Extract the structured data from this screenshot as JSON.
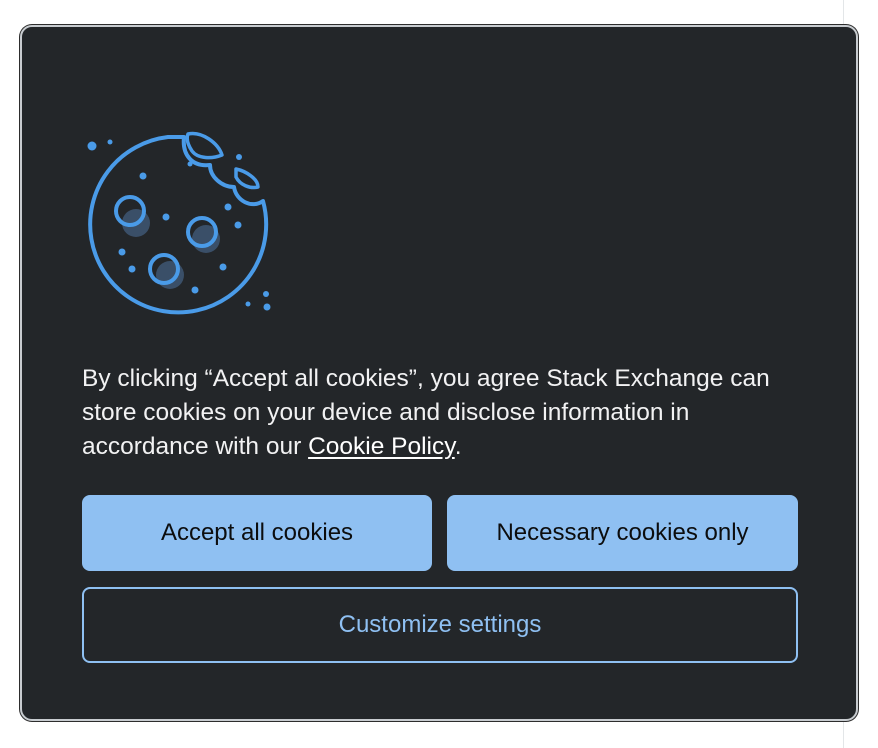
{
  "dialog": {
    "message_prefix": "By clicking “Accept all cookies”, you agree Stack Exchange can store cookies on your device and disclose information in accordance with our ",
    "policy_link": "Cookie Policy",
    "message_suffix": ".",
    "icon": "cookie-icon",
    "buttons": {
      "accept_all": "Accept all cookies",
      "necessary_only": "Necessary cookies only",
      "customize": "Customize settings"
    }
  },
  "colors": {
    "dialog_background": "#232629",
    "accent": "#8fc0f2",
    "icon": "#4a9be8"
  }
}
